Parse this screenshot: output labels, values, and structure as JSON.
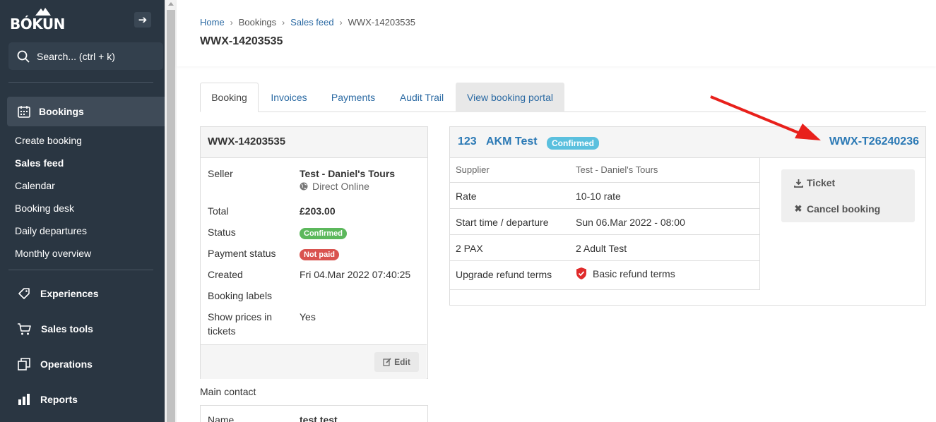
{
  "app": {
    "logo_text": "BÓKUN",
    "collapse_icon": "arrow-right-icon",
    "search_placeholder": "Search... (ctrl + k)"
  },
  "sidebar": {
    "bookings_label": "Bookings",
    "sub_items": [
      {
        "label": "Create booking",
        "active": false
      },
      {
        "label": "Sales feed",
        "active": true
      },
      {
        "label": "Calendar",
        "active": false
      },
      {
        "label": "Booking desk",
        "active": false
      },
      {
        "label": "Daily departures",
        "active": false
      },
      {
        "label": "Monthly overview",
        "active": false
      }
    ],
    "nav": [
      {
        "label": "Experiences",
        "icon": "tag-icon"
      },
      {
        "label": "Sales tools",
        "icon": "cart-icon"
      },
      {
        "label": "Operations",
        "icon": "copy-icon"
      },
      {
        "label": "Reports",
        "icon": "bar-chart-icon"
      }
    ]
  },
  "header": {
    "breadcrumb": [
      "Home",
      "Bookings",
      "Sales feed",
      "WWX-14203535"
    ],
    "title": "WWX-14203535"
  },
  "tabs": [
    "Booking",
    "Invoices",
    "Payments",
    "Audit Trail",
    "View booking portal"
  ],
  "booking_panel": {
    "title": "WWX-14203535",
    "seller_label": "Seller",
    "seller_name": "Test - Daniel's Tours",
    "seller_channel": "Direct Online",
    "total_label": "Total",
    "total_value": "£203.00",
    "status_label": "Status",
    "status_value": "Confirmed",
    "payment_status_label": "Payment status",
    "payment_status_value": "Not paid",
    "created_label": "Created",
    "created_value": "Fri 04.Mar 2022 07:40:25",
    "labels_label": "Booking labels",
    "show_prices_label_1": "Show prices in",
    "show_prices_label_2": "tickets",
    "show_prices_value": "Yes",
    "edit_label": "Edit"
  },
  "main_contact": {
    "heading": "Main contact",
    "name_label": "Name",
    "name_value": "test test"
  },
  "product_panel": {
    "ref": "123",
    "product": "AKM Test",
    "status": "Confirmed",
    "code": "WWX-T26240236",
    "rows": [
      {
        "label": "Supplier",
        "value": "Test - Daniel's Tours"
      },
      {
        "label": "Rate",
        "value": "10-10 rate"
      },
      {
        "label": "Start time / departure",
        "value": "Sun 06.Mar 2022 - 08:00"
      },
      {
        "label": "2 PAX",
        "value": "2 Adult Test"
      },
      {
        "label": "Upgrade refund terms",
        "value": "Basic refund terms"
      }
    ],
    "actions": {
      "ticket": "Ticket",
      "cancel": "Cancel booking"
    }
  },
  "colors": {
    "sidebar_bg": "#2a3642",
    "link": "#2b6aa3",
    "confirmed": "#5cb85c",
    "not_paid": "#d9534f",
    "annotation_arrow": "#e8201b"
  }
}
